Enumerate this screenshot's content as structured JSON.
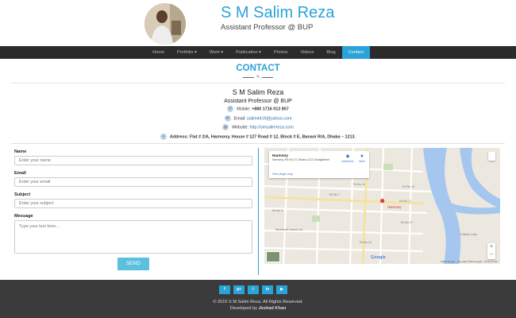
{
  "header": {
    "name": "S M Salim Reza",
    "subtitle": "Assistant Professor @ BUP"
  },
  "nav": {
    "items": [
      {
        "label": "Home"
      },
      {
        "label": "Portfolio ▾"
      },
      {
        "label": "Work ▾"
      },
      {
        "label": "Publication ▾"
      },
      {
        "label": "Photos"
      },
      {
        "label": "Videos"
      },
      {
        "label": "Blog"
      },
      {
        "label": "Contact",
        "active": true
      }
    ]
  },
  "contact": {
    "title": "CONTACT",
    "divider_icon": "pencil-icon",
    "name": "S M Salim Reza",
    "position": "Assistant Professor @ BUP",
    "mobile_label": "Mobile:",
    "mobile_value": "+880 1716 013 857",
    "email_label": "Email:",
    "email_value": "salim4419@yahoo.com",
    "website_label": "Website:",
    "website_value": "http://smsalimreza.com",
    "address_label": "Address:",
    "address_value": "Flat # 2/A, Harmony, House # 127 Road # 12, Block # E, Banani R/A, Dhaka – 1213.",
    "icons": {
      "mobile": "phone-icon",
      "email": "envelope-icon",
      "website": "globe-icon",
      "address": "map-marker-icon"
    }
  },
  "form": {
    "name_label": "Name",
    "name_placeholder": "Enter your name",
    "email_label": "Email",
    "email_placeholder": "Enter your email",
    "subject_label": "Subject",
    "subject_placeholder": "Enter your subject",
    "message_label": "Message",
    "message_placeholder": "Type your text here...",
    "send_label": "SEND"
  },
  "map": {
    "place_title": "Harmony",
    "place_address": "Harmony, Rd No 13, Dhaka 1213, Bangladesh",
    "larger_map": "View larger map",
    "directions": "Directions",
    "save": "Save",
    "pin_label": "Harmony",
    "copyright": "©2015 Google · Map data ©2015 Google · Terms of Use",
    "logo": "Google",
    "streets": [
      "Rd No 17",
      "Rd No 7",
      "Rd No 11",
      "Rd No 13",
      "Rd No 27",
      "Rd No 5",
      "Rd No 23"
    ],
    "poi": "Westlands House Ltd",
    "area": "Gulshan Lake"
  },
  "footer": {
    "social": [
      {
        "icon": "facebook-icon",
        "glyph": "f"
      },
      {
        "icon": "google-plus-icon",
        "glyph": "g+"
      },
      {
        "icon": "twitter-icon",
        "glyph": "t"
      },
      {
        "icon": "linkedin-icon",
        "glyph": "in"
      },
      {
        "icon": "youtube-icon",
        "glyph": "▶"
      }
    ],
    "copyright": "© 2015 S M Salim Reza. All Rights Reserved.",
    "developed_by": "Developed by",
    "developer": "Jeshad Khan"
  },
  "colors": {
    "accent": "#29a3d8",
    "nav_bg": "#2b2b2b",
    "footer_bg": "#3b3b3b",
    "send_button": "#5bc0de"
  }
}
